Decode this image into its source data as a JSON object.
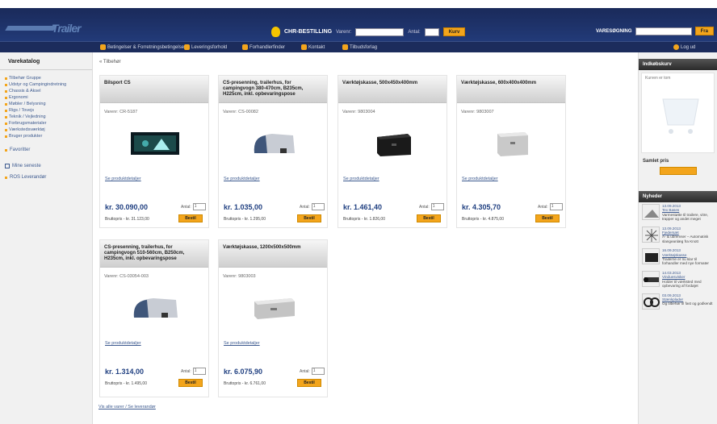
{
  "header": {
    "logo_text": "Trailer",
    "quick_order_label": "CHR-BESTILLING",
    "quick_varenr_label": "Varenr:",
    "quick_antal_label": "Antal:",
    "quick_button": "Kurv",
    "search_label": "VARESØGNING",
    "search_button": "Fra"
  },
  "nav": [
    {
      "label": "Betingelser & Forretningsbetingelser"
    },
    {
      "label": "Leveringsforhold"
    },
    {
      "label": "Forhandlerfinder"
    },
    {
      "label": "Kontakt"
    },
    {
      "label": "Tilbudsforlag"
    }
  ],
  "nav_right": "Log ud",
  "sidebar": {
    "title": "Varekatalog",
    "items": [
      "Tilbehør Gruppe",
      "Udstyr og Campingindretning",
      "Chassis & Aksel",
      "Ergonomi",
      "Møbler / Belysning",
      "Rigs / Tovejs",
      "Teknik / Vejledning",
      "Forbrugsmaterialer",
      "Værkstedsværktøj",
      "Bruger produkter"
    ],
    "extra_1": "Favoritter",
    "extra_2": "Mine seneste",
    "extra_3": "ROS Leverandør"
  },
  "breadcrumb": "« Tilbehør",
  "products": [
    {
      "title": "Bilsport CS",
      "num": "Varenr: CR-5187",
      "info": "Se produktdetaljer",
      "price": "kr. 30.090,00",
      "qty_label": "Antal:",
      "qty": "1",
      "sub": "Bruttopris - kr. 31.123,00",
      "buy": "Bestil"
    },
    {
      "title": "CS-presenning, trailerhus, for campingvogn 380-470cm, B235cm, H225cm, inkl. opbevaringspose",
      "num": "Varenr: CS-00082",
      "info": "Se produktdetaljer",
      "price": "kr. 1.035,00",
      "qty_label": "Antal:",
      "qty": "1",
      "sub": "Bruttopris - kr. 1.295,00",
      "buy": "Bestil"
    },
    {
      "title": "Værktøjskasse, 500x450x400mm",
      "num": "Varenr: 9803004",
      "info": "Se produktdetaljer",
      "price": "kr. 1.461,40",
      "qty_label": "Antal:",
      "qty": "1",
      "sub": "Bruttopris - kr. 1.826,00",
      "buy": "Bestil"
    },
    {
      "title": "Værktøjskasse, 600x400x400mm",
      "num": "Varenr: 9803007",
      "info": "Se produktdetaljer",
      "price": "kr. 4.305,70",
      "qty_label": "Antal:",
      "qty": "1",
      "sub": "Bruttopris - kr. 4.875,00",
      "buy": "Bestil"
    },
    {
      "title": "CS-presenning, trailerhus, for campingvogn 510-560cm, B250cm, H235cm, inkl. opbevaringspose",
      "num": "Varenr: CS-03054-003",
      "info": "Se produktdetaljer",
      "price": "kr. 1.314,00",
      "qty_label": "Antal:",
      "qty": "1",
      "sub": "Bruttopris - kr. 1.495,00",
      "buy": "Bestil"
    },
    {
      "title": "Værktøjskasse, 1200x500x500mm",
      "num": "Varenr: 9803003",
      "info": "Se produktdetaljer",
      "price": "kr. 6.075,90",
      "qty_label": "Antal:",
      "qty": "1",
      "sub": "Bruttopris - kr. 6.761,00",
      "buy": "Bestil"
    }
  ],
  "bottom_link": "Vis alle varer / Se leverandør",
  "right": {
    "basket_title": "Indkøbskurv",
    "basket_text": "Kurven er tom",
    "basket_sum": "Samlet pris",
    "news_title": "Nyheder",
    "news": [
      {
        "date": "13.09.2013",
        "head": "Tex Bases",
        "text": "Varmestøtte til trailere, vitre, trapper og andet meget"
      },
      {
        "date": "13.09.2013",
        "head": "Fjedersæt",
        "text": "A- & ubremser – Automatisk slangeanlæg fra Knott"
      },
      {
        "date": "16.09.2013",
        "head": "Værktøjskasse",
        "text": "Trailerne er nu klar til forhandler med nye formater"
      },
      {
        "date": "14.03.2013",
        "head": "Vinduesvisker",
        "text": "Holder til værksted med opbevaring af fordøjet"
      },
      {
        "date": "03.09.2013",
        "head": "Stænkplader",
        "text": "Og tilbehør til fast og godkendt"
      }
    ]
  }
}
